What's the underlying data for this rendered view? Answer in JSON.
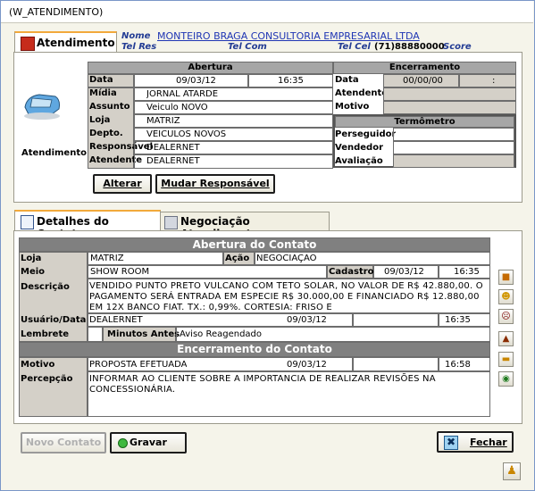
{
  "window": {
    "title": "(W_ATENDIMENTO)"
  },
  "tabs_top": [
    {
      "label": "Atendimento"
    }
  ],
  "header": {
    "nome_label": "Nome",
    "nome_value": "MONTEIRO BRAGA CONSULTORIA EMPRESARIAL LTDA",
    "telres_label": "Tel Res",
    "telcom_label": "Tel Com",
    "telcel_label": "Tel Cel",
    "telcel_value": "(71)88880000",
    "score_label": "Score"
  },
  "atendimento_icon_label": "Atendimento",
  "abertura": {
    "title": "Abertura",
    "data_label": "Data",
    "data_value": "09/03/12",
    "hora_value": "16:35",
    "midia_label": "Mídia",
    "midia_value": "JORNAL ATARDE",
    "assunto_label": "Assunto",
    "assunto_value": "Veiculo NOVO",
    "loja_label": "Loja",
    "loja_value": "MATRIZ",
    "depto_label": "Depto.",
    "depto_value": "VEICULOS NOVOS",
    "responsavel_label": "Responsável",
    "responsavel_value": "DEALERNET",
    "atendente_label": "Atendente",
    "atendente_value": "DEALERNET"
  },
  "encerramento": {
    "title": "Encerramento",
    "data_label": "Data",
    "data_value": "00/00/00",
    "hora_value": ":",
    "atendente_label": "Atendente",
    "motivo_label": "Motivo"
  },
  "termometro": {
    "title": "Termômetro",
    "perseguidor_label": "Perseguidor",
    "vendedor_label": "Vendedor",
    "avaliacao_label": "Avaliação"
  },
  "buttons_top": {
    "alterar": "Alterar",
    "mudar_responsavel": "Mudar Responsável"
  },
  "tabs_bottom": [
    {
      "label": "Detalhes do Contato"
    },
    {
      "label": "Negociação Atendimento"
    }
  ],
  "contato": {
    "abertura_title": "Abertura do Contato",
    "loja_label": "Loja",
    "loja_value": "MATRIZ",
    "acao_label": "Ação",
    "acao_value": "NEGOCIAÇÃO",
    "meio_label": "Meio",
    "meio_value": "SHOW ROOM",
    "cadastro_label": "Cadastro",
    "cadastro_date": "09/03/12",
    "cadastro_time": "16:35",
    "descricao_label": "Descrição",
    "descricao_value": "VENDIDO PUNTO PRETO VULCANO COM TETO SOLAR, NO VALOR DE R$ 42.880,00. O PAGAMENTO SERÁ ENTRADA EM ESPECIE R$ 30.000,00 E FINANCIADO R$ 12.880,00 EM 12X BANCO FIAT. TX.: 0,99%. CORTESIA: FRISO E",
    "usuario_label": "Usuário/Data",
    "usuario_value": "DEALERNET",
    "usuario_date": "09/03/12",
    "usuario_time": "16:35",
    "lembrete_label": "Lembrete",
    "minutos_label": "Minutos Antes",
    "aviso_value": "Aviso Reagendado",
    "encerramento_title": "Encerramento do Contato",
    "motivo_label": "Motivo",
    "motivo_value": "PROPOSTA EFETUADA",
    "motivo_date": "09/03/12",
    "motivo_time": "16:58",
    "percepcao_label": "Percepção",
    "percepcao_value": "INFORMAR AO CLIENTE SOBRE A IMPORTANCIA DE REALIZAR REVISÕES NA CONCESSIONÁRIA."
  },
  "buttons_bottom": {
    "novo_contato": "Novo Contato",
    "gravar": "Gravar",
    "fechar": "Fechar"
  }
}
